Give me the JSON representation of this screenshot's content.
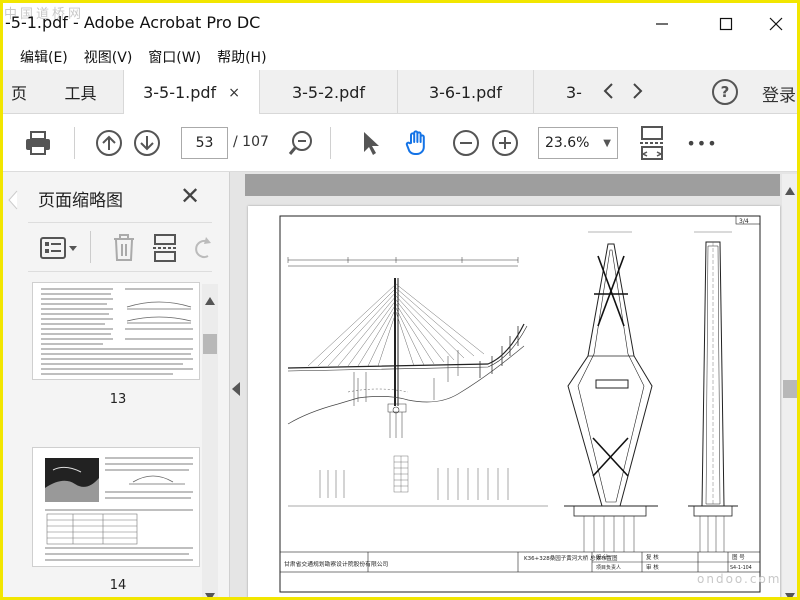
{
  "window": {
    "title": "-5-1.pdf - Adobe Acrobat Pro DC",
    "watermark": "中国道桥网",
    "controls": [
      "minimize-icon",
      "maximize-icon",
      "close-icon"
    ]
  },
  "menu": {
    "items": [
      {
        "label": "编辑(E)"
      },
      {
        "label": "视图(V)"
      },
      {
        "label": "窗口(W)"
      },
      {
        "label": "帮助(H)"
      }
    ]
  },
  "tabs": {
    "home_label": "页",
    "tools_label": "工具",
    "documents": [
      {
        "label": "3-5-1.pdf",
        "active": true,
        "close": "×"
      },
      {
        "label": "3-5-2.pdf",
        "active": false
      },
      {
        "label": "3-6-1.pdf",
        "active": false
      },
      {
        "label": "3-",
        "active": false
      }
    ],
    "prev_icon": "chevron-left-icon",
    "next_icon": "chevron-right-icon",
    "help_label": "?",
    "login_label": "登录"
  },
  "toolbar": {
    "current_page": "53",
    "total_pages": "/ 107",
    "zoom_value": "23.6%",
    "zoom_caret": "▼",
    "more_label": "•••",
    "icons": [
      "print-icon",
      "page-up-icon",
      "page-down-icon",
      "zoom-search-icon",
      "select-arrow-icon",
      "hand-tool-icon",
      "zoom-out-icon",
      "zoom-in-icon",
      "fit-page-icon",
      "more-icon"
    ],
    "accent_color": "#1473e6"
  },
  "thumbnail_panel": {
    "title": "页面缩略图",
    "close_label": "✕",
    "thumbnails": [
      {
        "page": "13"
      },
      {
        "page": "14"
      }
    ]
  },
  "document": {
    "sheet_number": "3/4",
    "company": "甘肃省交通规划勘察设计院股份有限公司",
    "drawing_title": "K36+328桑园子黄河大桥 总体布置图",
    "drawing_no": "S4-1-104",
    "labels": {
      "design": "设 计",
      "review": "复 核",
      "approve": "审 核",
      "chief": "项目负责人",
      "drawing_label": "图 号"
    }
  },
  "footer_watermark": "ondoo.com"
}
